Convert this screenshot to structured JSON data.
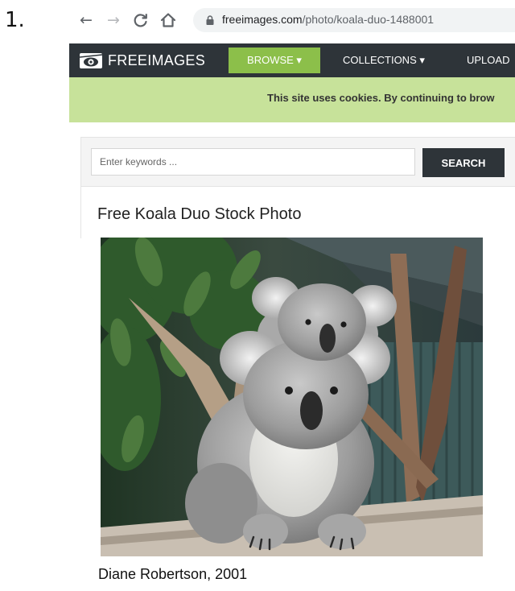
{
  "document": {
    "list_number": "1.",
    "caption": "Diane Robertson, 2001"
  },
  "browser": {
    "url_domain": "freeimages.com",
    "url_path": "/photo/koala-duo-1488001"
  },
  "site": {
    "logo_text": "FREEIMAGES",
    "nav": {
      "browse": "BROWSE ▾",
      "collections": "COLLECTIONS ▾",
      "upload": "UPLOAD"
    },
    "cookie_notice": "This site uses cookies. By continuing to brow",
    "search": {
      "placeholder": "Enter keywords ...",
      "button_label": "SEARCH"
    },
    "photo_title": "Free Koala Duo Stock Photo"
  },
  "icons": {
    "back": "back-arrow-icon",
    "forward": "forward-arrow-icon",
    "reload": "reload-icon",
    "home": "home-icon",
    "lock": "lock-icon",
    "logo": "camera-eye-logo-icon"
  },
  "colors": {
    "header_bg": "#2e3439",
    "accent_green": "#8cbf4a",
    "cookie_bg": "#c7e29a"
  }
}
